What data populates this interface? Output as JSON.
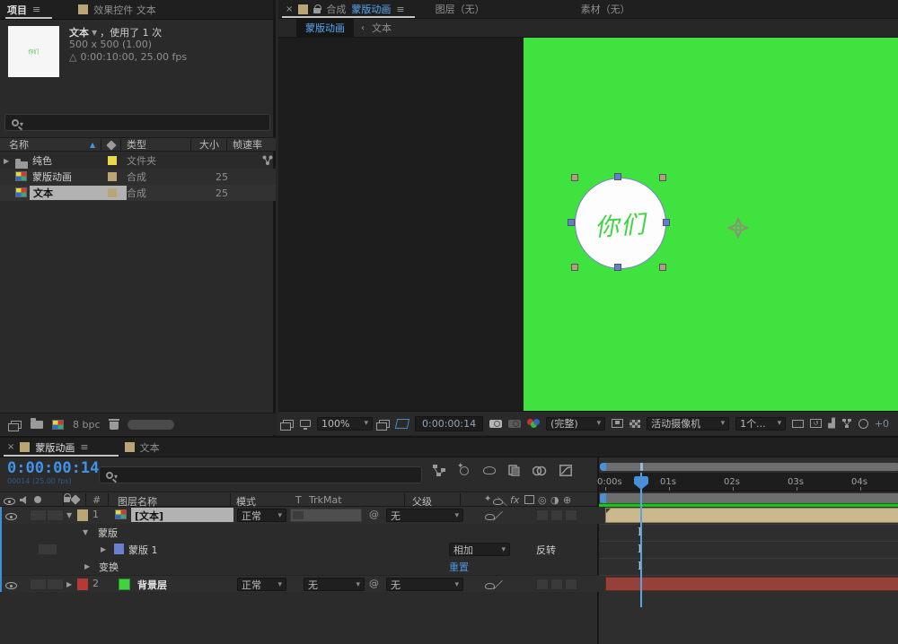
{
  "project": {
    "tabs": {
      "project": "项目",
      "effect_controls": "效果控件 文本"
    },
    "info": {
      "name": "文本",
      "usage": "，使用了 1 次",
      "dimensions": "500 x 500 (1.00)",
      "duration": "0:00:10:00, 25.00 fps"
    },
    "table": {
      "col_name": "名称",
      "col_type": "类型",
      "col_size": "大小",
      "col_fps": "帧速率",
      "rows": [
        {
          "name": "纯色",
          "type": "文件夹",
          "fps": ""
        },
        {
          "name": "蒙版动画",
          "type": "合成",
          "fps": "25"
        },
        {
          "name": "文本",
          "type": "合成",
          "fps": "25"
        }
      ]
    },
    "footer": {
      "bpc": "8 bpc"
    }
  },
  "viewer": {
    "tab_comp_prefix": "合成",
    "tab_comp_name": "蒙版动画",
    "tab_layer": "图层（无）",
    "tab_footage": "素材（无）",
    "subtab_active": "蒙版动画",
    "subtab_other": "文本",
    "canvas": {
      "text": "你们"
    },
    "toolbar": {
      "zoom": "100%",
      "timecode": "0:00:00:14",
      "channel": "(完整)",
      "camera": "活动摄像机",
      "view_count": "1个...",
      "plus": "+0"
    }
  },
  "timeline": {
    "tab_active": "蒙版动画",
    "tab_other": "文本",
    "timecode": "0:00:00:14",
    "frames": "00014 (25.00 fps)",
    "cols": {
      "num": "#",
      "layer_name": "图层名称",
      "mode": "模式",
      "t": "T",
      "trkmat": "TrkMat",
      "parent": "父级"
    },
    "ruler": [
      "0:00s",
      "01s",
      "02s",
      "03s",
      "04s"
    ],
    "layers": {
      "l1": {
        "num": "1",
        "name": "[文本]",
        "mode": "正常",
        "parent": "无"
      },
      "masks_group": "蒙版",
      "mask1": {
        "name": "蒙版 1",
        "mode": "相加",
        "inverted": "反转"
      },
      "transform": {
        "name": "变换",
        "reset": "重置"
      },
      "l2": {
        "num": "2",
        "name": "背景层",
        "mode": "正常",
        "trkmat": "无",
        "parent": "无"
      }
    }
  },
  "colors": {
    "accent_blue": "#4596e0",
    "timecode_blue": "#3f94e8",
    "comp_green": "#3fe23f",
    "label_tan": "#b9a575",
    "label_red": "#b53a35",
    "label_blue": "#6b7fd0",
    "label_green": "#3fd43f",
    "layerbar_tan": "#cbb88c",
    "layerbar_red": "#96403a"
  }
}
